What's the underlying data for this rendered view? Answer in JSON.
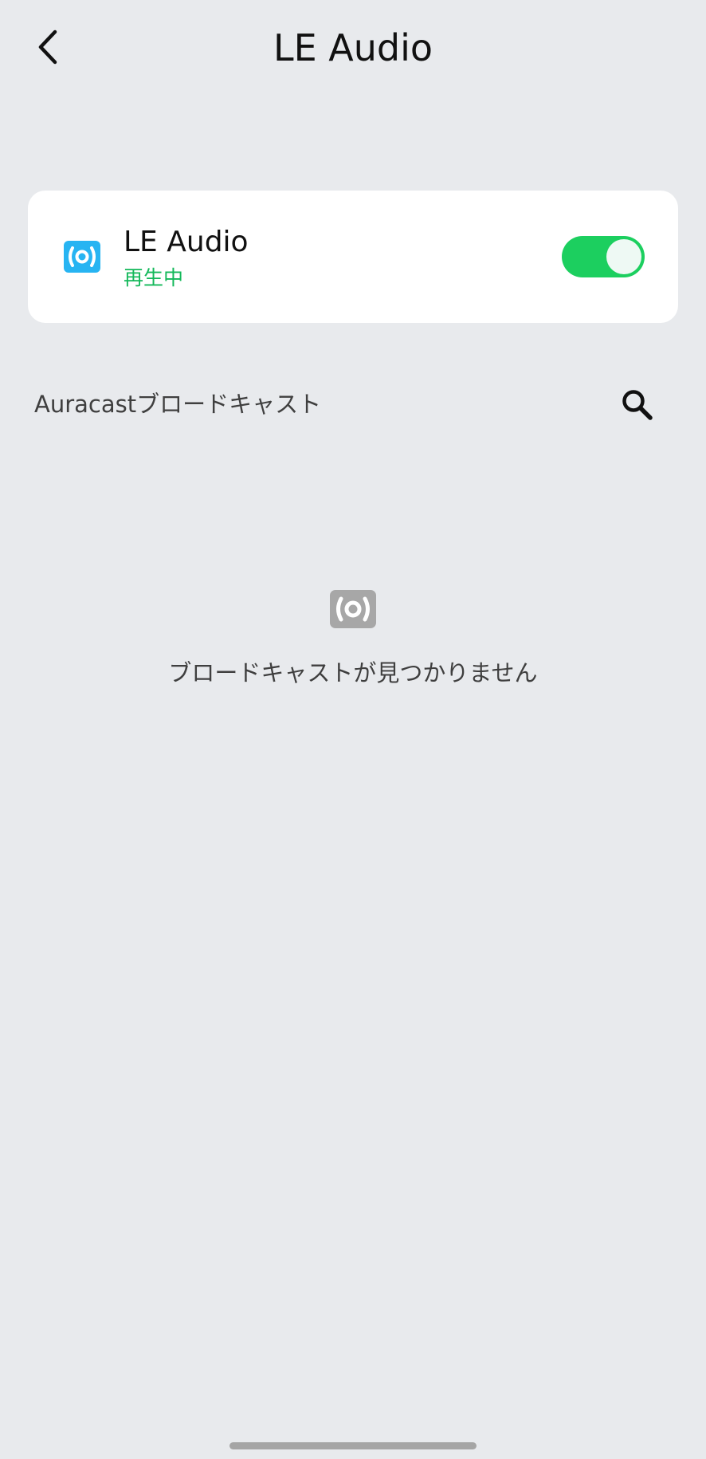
{
  "header": {
    "title": "LE Audio"
  },
  "card": {
    "title": "LE Audio",
    "status": "再生中",
    "toggle_on": true,
    "icon": "broadcast-icon"
  },
  "section": {
    "label": "Auracastブロードキャスト",
    "search_icon": "search-icon"
  },
  "empty_state": {
    "icon": "broadcast-icon",
    "text": "ブロードキャストが見つかりません"
  },
  "colors": {
    "background": "#e8eaed",
    "card": "#ffffff",
    "accent_green": "#1ccf5f",
    "status_green": "#13b85a",
    "broadcast_blue": "#27b4f2",
    "empty_icon_gray": "#a7a7a7"
  }
}
